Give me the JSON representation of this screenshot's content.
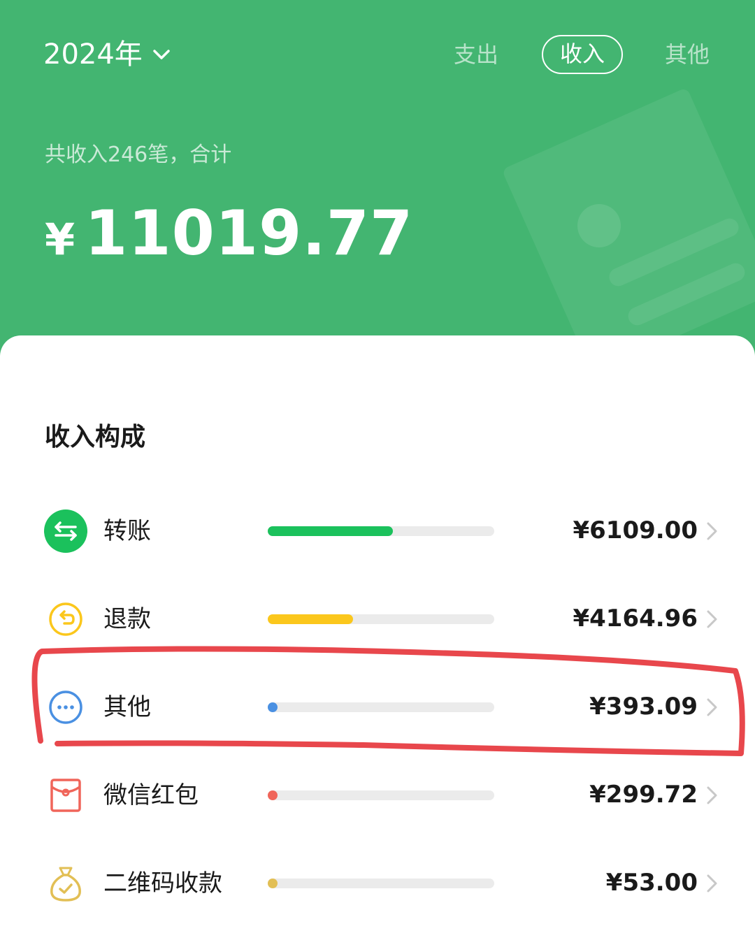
{
  "header": {
    "year_label": "2024年",
    "tabs": [
      {
        "label": "支出",
        "active": false
      },
      {
        "label": "收入",
        "active": true
      },
      {
        "label": "其他",
        "active": false
      }
    ],
    "summary": "共收入246笔，合计",
    "currency": "¥",
    "total": "11019.77",
    "bg_color": "#43b571"
  },
  "composition": {
    "title": "收入构成",
    "items": [
      {
        "label": "转账",
        "amount": "¥6109.00",
        "share": 0.554,
        "color": "#1bc15c",
        "icon": "transfer-icon"
      },
      {
        "label": "退款",
        "amount": "¥4164.96",
        "share": 0.378,
        "color": "#fbc71c",
        "icon": "refund-icon"
      },
      {
        "label": "其他",
        "amount": "¥393.09",
        "share": 0.036,
        "color": "#4a90e2",
        "icon": "more-icon"
      },
      {
        "label": "微信红包",
        "amount": "¥299.72",
        "share": 0.027,
        "color": "#f0655a",
        "icon": "red-packet-icon"
      },
      {
        "label": "二维码收款",
        "amount": "¥53.00",
        "share": 0.005,
        "color": "#e2bf55",
        "icon": "money-bag-icon"
      }
    ]
  },
  "annotation": {
    "color": "#e8474c"
  }
}
